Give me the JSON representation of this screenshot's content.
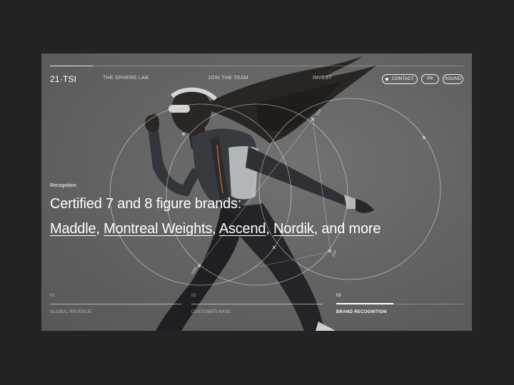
{
  "brand": {
    "logo": "21·TSI"
  },
  "nav": {
    "links": [
      "THE SPHERE LAB",
      "JOIN THE TEAM",
      "INVEST"
    ],
    "contact": "CONTACT",
    "lang": "FR",
    "sound": "SOUND"
  },
  "hero": {
    "eyebrow": "Recognition",
    "headline": "Certified 7 and 8 figure brands:",
    "brands": [
      "Maddle",
      "Montreal Weights",
      "Ascend",
      "Nordik"
    ],
    "sep": ", ",
    "tail": ", and more"
  },
  "diagram": {
    "labels": [
      "EE8",
      "SS0",
      "0068"
    ]
  },
  "tabs": [
    {
      "num": "01",
      "label": "GLOBAL REVENUE"
    },
    {
      "num": "02",
      "label": "CUSTOMER BASE"
    },
    {
      "num": "03",
      "label": "BRAND RECOGNITION"
    }
  ],
  "active_tab": 2,
  "active_tab_progress": 0.45,
  "colors": {
    "page_bg": "#232323",
    "frame_bg": "#6d6d6d",
    "text": "#ffffff"
  }
}
